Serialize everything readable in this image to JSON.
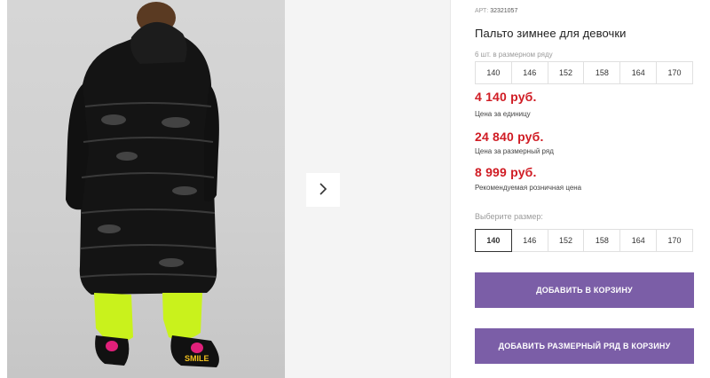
{
  "product": {
    "article_label": "АРТ:",
    "article_value": "32321057",
    "title": "Пальто зимнее для девочки",
    "row_label": "6 шт. в размерном ряду",
    "row_sizes": [
      "140",
      "146",
      "152",
      "158",
      "164",
      "170"
    ],
    "prices": [
      {
        "value": "4 140 руб.",
        "note": "Цена за единицу"
      },
      {
        "value": "24 840 руб.",
        "note": "Цена за размерный ряд"
      },
      {
        "value": "8 999 руб.",
        "note": "Рекомендуемая розничная цена"
      }
    ],
    "choose_label": "Выберите размер:",
    "select_sizes": [
      "140",
      "146",
      "152",
      "158",
      "164",
      "170"
    ],
    "selected_size": "140",
    "add_to_cart": "ДОБАВИТЬ В КОРЗИНУ",
    "add_row_to_cart": "ДОБАВИТЬ РАЗМЕРНЫЙ РЯД В КОРЗИНУ"
  },
  "gallery": {
    "next_icon": "chevron-right-icon",
    "shoe_text": "SMILE"
  },
  "colors": {
    "price": "#d01c24",
    "button": "#7b5ea7"
  }
}
